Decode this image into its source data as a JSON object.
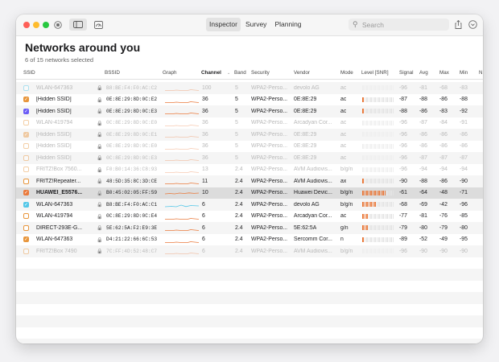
{
  "toolbar": {
    "tabs": [
      "Inspector",
      "Survey",
      "Planning"
    ],
    "active_tab": 0,
    "search_placeholder": "Search"
  },
  "header": {
    "title": "Networks around you",
    "subtitle": "6 of 15 networks selected"
  },
  "columns": {
    "ssid": "SSID",
    "bssid": "BSSID",
    "graph": "Graph",
    "channel": "Channel",
    "band": "Band",
    "security": "Security",
    "vendor": "Vendor",
    "mode": "Mode",
    "level": "Level [SNR]",
    "signal": "Signal",
    "avg": "Avg",
    "max": "Max",
    "min": "Min",
    "more": "N"
  },
  "colors": {
    "orange": "#ea7a3c",
    "cyan": "#54c7e8",
    "purple": "#6b5cf6"
  },
  "networks": [
    {
      "ssid": "WLAN-647363",
      "bssid": "B8:BE:F4:F0:AC:C2",
      "channel": "100",
      "band": "5",
      "security": "WPA2-Perso...",
      "vendor": "devolo AG",
      "mode": "ac",
      "signal": "-96",
      "avg": "-81",
      "max": "-68",
      "min": "-83",
      "checked": false,
      "check_color": "#54c7e8",
      "dim": true,
      "bars": 0,
      "graph_color": "#ea7a3c"
    },
    {
      "ssid": "[Hidden SSID]",
      "bssid": "0E:8E:29:8D:0C:E2",
      "channel": "36",
      "band": "5",
      "security": "WPA2-Perso...",
      "vendor": "0E:8E:29",
      "mode": "ac",
      "signal": "-87",
      "avg": "-88",
      "max": "-86",
      "min": "-88",
      "checked": true,
      "check_color": "#e8963c",
      "dim": false,
      "bars": 1,
      "graph_color": "#ea7a3c"
    },
    {
      "ssid": "[Hidden SSID]",
      "bssid": "0E:8E:29:8D:0C:E3",
      "channel": "36",
      "band": "5",
      "security": "WPA2-Perso...",
      "vendor": "0E:8E:29",
      "mode": "ac",
      "signal": "-88",
      "avg": "-86",
      "max": "-83",
      "min": "-92",
      "checked": true,
      "check_color": "#6b5cf6",
      "dim": false,
      "bars": 1,
      "graph_color": "#ea7a3c"
    },
    {
      "ssid": "WLAN-419794",
      "bssid": "0C:8E:29:8D:0C:E0",
      "channel": "36",
      "band": "5",
      "security": "WPA2-Perso...",
      "vendor": "Arcadyan Cor...",
      "mode": "ac",
      "signal": "-96",
      "avg": "-87",
      "max": "-84",
      "min": "-91",
      "checked": false,
      "check_color": "#e8963c",
      "dim": true,
      "bars": 0,
      "graph_color": "#ea7a3c"
    },
    {
      "ssid": "[Hidden SSID]",
      "bssid": "0E:8E:29:8D:0C:E1",
      "channel": "36",
      "band": "5",
      "security": "WPA2-Perso...",
      "vendor": "0E:8E:29",
      "mode": "ac",
      "signal": "-96",
      "avg": "-86",
      "max": "-86",
      "min": "-86",
      "checked": true,
      "check_color": "#e8963c",
      "dim": true,
      "bars": 0,
      "graph_color": "#ea7a3c"
    },
    {
      "ssid": "[Hidden SSID]",
      "bssid": "0E:8E:29:8D:0C:E0",
      "channel": "36",
      "band": "5",
      "security": "WPA2-Perso...",
      "vendor": "0E:8E:29",
      "mode": "ac",
      "signal": "-96",
      "avg": "-86",
      "max": "-86",
      "min": "-86",
      "checked": false,
      "check_color": "#e8963c",
      "dim": true,
      "bars": 0,
      "graph_color": "#ea7a3c"
    },
    {
      "ssid": "[Hidden SSID]",
      "bssid": "0C:8E:29:8D:0C:E3",
      "channel": "36",
      "band": "5",
      "security": "WPA2-Perso...",
      "vendor": "0E:8E:29",
      "mode": "ac",
      "signal": "-96",
      "avg": "-87",
      "max": "-87",
      "min": "-87",
      "checked": false,
      "check_color": "#e8963c",
      "dim": true,
      "bars": 0,
      "graph_color": "#ea7a3c"
    },
    {
      "ssid": "FRITZ!Box 7560...",
      "bssid": "F0:B0:14:36:C8:93",
      "channel": "13",
      "band": "2.4",
      "security": "WPA2-Perso...",
      "vendor": "AVM Audiovis...",
      "mode": "b/g/n",
      "signal": "-96",
      "avg": "-94",
      "max": "-94",
      "min": "-94",
      "checked": false,
      "check_color": "#e8963c",
      "dim": true,
      "bars": 0,
      "graph_color": "#ea7a3c"
    },
    {
      "ssid": "FRITZ!Repeater...",
      "bssid": "48:5D:35:8C:3D:CE",
      "channel": "11",
      "band": "2.4",
      "security": "WPA2-Perso...",
      "vendor": "AVM Audiovis...",
      "mode": "ax",
      "signal": "-90",
      "avg": "-88",
      "max": "-86",
      "min": "-90",
      "checked": false,
      "check_color": "#e8963c",
      "dim": false,
      "bars": 1,
      "graph_color": "#ea7a3c"
    },
    {
      "ssid": "HUAWEI_E5576...",
      "bssid": "B0:45:02:05:FF:59",
      "channel": "10",
      "band": "2.4",
      "security": "WPA2-Perso...",
      "vendor": "Huawei Devic...",
      "mode": "b/g/n",
      "signal": "-61",
      "avg": "-64",
      "max": "-48",
      "min": "-71",
      "checked": true,
      "check_color": "#ea7a3c",
      "dim": false,
      "selected": true,
      "bars": 12,
      "graph_color": "#ea7a3c"
    },
    {
      "ssid": "WLAN-647363",
      "bssid": "B8:BE:F4:F0:AC:C1",
      "channel": "6",
      "band": "2.4",
      "security": "WPA2-Perso...",
      "vendor": "devolo AG",
      "mode": "b/g/n",
      "signal": "-68",
      "avg": "-69",
      "max": "-42",
      "min": "-96",
      "checked": true,
      "check_color": "#54c7e8",
      "dim": false,
      "bars": 7,
      "graph_color": "#54c7e8"
    },
    {
      "ssid": "WLAN-419794",
      "bssid": "0C:8E:29:8D:0C:E4",
      "channel": "6",
      "band": "2.4",
      "security": "WPA2-Perso...",
      "vendor": "Arcadyan Cor...",
      "mode": "ac",
      "signal": "-77",
      "avg": "-81",
      "max": "-76",
      "min": "-85",
      "checked": false,
      "check_color": "#e8963c",
      "dim": false,
      "bars": 3,
      "graph_color": "#ea7a3c"
    },
    {
      "ssid": "DIRECT-293E-G...",
      "bssid": "5E:62:5A:F2:E9:3E",
      "channel": "6",
      "band": "2.4",
      "security": "WPA2-Perso...",
      "vendor": "5E:62:5A",
      "mode": "g/n",
      "signal": "-79",
      "avg": "-80",
      "max": "-79",
      "min": "-80",
      "checked": false,
      "check_color": "#e8963c",
      "dim": false,
      "bars": 3,
      "graph_color": "#ea7a3c"
    },
    {
      "ssid": "WLAN-647363",
      "bssid": "D4:21:22:66:6C:53",
      "channel": "6",
      "band": "2.4",
      "security": "WPA2-Perso...",
      "vendor": "Sercomm Cor...",
      "mode": "n",
      "signal": "-89",
      "avg": "-52",
      "max": "-49",
      "min": "-95",
      "checked": true,
      "check_color": "#e8963c",
      "dim": false,
      "bars": 1,
      "graph_color": "#ea7a3c"
    },
    {
      "ssid": "FRITZ!Box 7490",
      "bssid": "7C:FF:4D:52:48:C7",
      "channel": "6",
      "band": "2.4",
      "security": "WPA2-Perso...",
      "vendor": "AVM Audiovis...",
      "mode": "b/g/n",
      "signal": "-96",
      "avg": "-90",
      "max": "-90",
      "min": "-90",
      "checked": false,
      "check_color": "#e8963c",
      "dim": true,
      "bars": 0,
      "graph_color": "#ea7a3c"
    }
  ]
}
